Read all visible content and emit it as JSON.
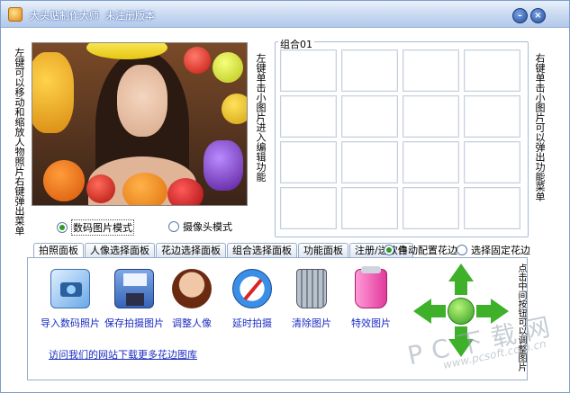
{
  "window": {
    "title": "大头贴制作大师  未注册版本",
    "minimize_label": "–",
    "close_label": "×"
  },
  "left_hint": "左键可以移动和缩放人物照片右键弹出菜单",
  "middle_hint": "左键单击小图片进入编辑功能",
  "right_hint": "右键单击小图片可以弹出功能菜单",
  "group": {
    "title": "组合01",
    "rows": 4,
    "cols": 4
  },
  "mode_radios": [
    {
      "label": "数码图片模式",
      "checked": true
    },
    {
      "label": "摄像头模式",
      "checked": false
    }
  ],
  "tabs": [
    {
      "label": "拍照面板",
      "active": true
    },
    {
      "label": "人像选择面板",
      "active": false
    },
    {
      "label": "花边选择面板",
      "active": false
    },
    {
      "label": "组合选择面板",
      "active": false
    },
    {
      "label": "功能面板",
      "active": false
    },
    {
      "label": "注册/送软件",
      "active": false
    }
  ],
  "frame_radios": [
    {
      "label": "自动配置花边",
      "checked": true
    },
    {
      "label": "选择固定花边",
      "checked": false
    }
  ],
  "tools": [
    {
      "label": "导入数码照片",
      "icon": "import-photo-icon"
    },
    {
      "label": "保存拍摄图片",
      "icon": "save-floppy-icon"
    },
    {
      "label": "调整人像",
      "icon": "portrait-icon"
    },
    {
      "label": "延时拍摄",
      "icon": "compass-timer-icon"
    },
    {
      "label": "清除图片",
      "icon": "trash-bin-icon"
    },
    {
      "label": "特效图片",
      "icon": "effects-jar-icon"
    }
  ],
  "download_link": "访问我们的网站下载更多花边图库",
  "dpad_hint": "点击中间按钮可以调整图片",
  "watermark": {
    "big": "PC下载网",
    "small": "www.pcsoft.com.cn"
  },
  "colors": {
    "titlebar": "#b3c9ea",
    "link": "#1a2cc0",
    "arrow_green": "#2e9a1e"
  }
}
